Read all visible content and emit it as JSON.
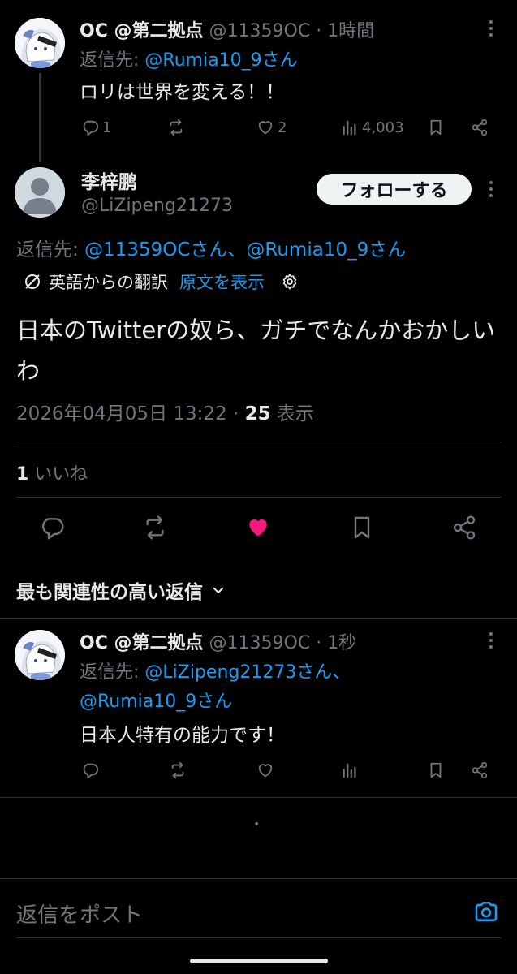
{
  "parent_tweet": {
    "display_name": "OC @第二拠点",
    "handle": "@11359OC",
    "separator": "·",
    "time": "1時間",
    "reply_to_label": "返信先: ",
    "reply_to_link": "@Rumia10_9さん",
    "text": "ロリは世界を変える！！",
    "reply_count": "1",
    "like_count": "2",
    "view_count": "4,003"
  },
  "main_tweet": {
    "display_name": "李梓鹏",
    "handle": "@LiZipeng21273",
    "follow_button": "フォローする",
    "reply_to_label": "返信先: ",
    "reply_to_link1": "@11359OCさん",
    "reply_to_sep": "、",
    "reply_to_link2": "@Rumia10_9さん",
    "translated_label": "英語からの翻訳",
    "show_original": "原文を表示",
    "text": "日本のTwitterの奴ら、ガチでなんかおかしいわ",
    "timestamp": "2026年04月05日 13:22",
    "separator": "·",
    "views_count": "25",
    "views_label": " 表示",
    "likes_count": "1",
    "likes_label": " いいね",
    "like_color": "#f91880"
  },
  "sort": {
    "label": "最も関連性の高い返信"
  },
  "reply_tweet": {
    "display_name": "OC @第二拠点",
    "handle": "@11359OC",
    "separator": "·",
    "time": "1秒",
    "reply_to_label": "返信先: ",
    "reply_to_link1": "@LiZipeng21273さん、",
    "reply_to_link2": "@Rumia10_9さん",
    "text": "日本人特有の能力です！"
  },
  "loading_dot": "•",
  "composer": {
    "placeholder": "返信をポスト"
  },
  "colors": {
    "accent": "#1d9bf0",
    "background": "#000000",
    "like": "#f91880"
  }
}
